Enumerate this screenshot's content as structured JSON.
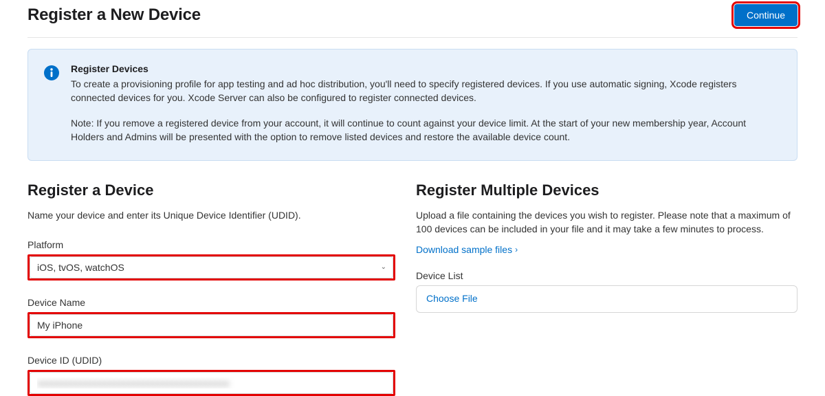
{
  "header": {
    "title": "Register a New Device",
    "continue_label": "Continue"
  },
  "info": {
    "heading": "Register Devices",
    "body1": "To create a provisioning profile for app testing and ad hoc distribution, you'll need to specify registered devices. If you use automatic signing, Xcode registers connected devices for you. Xcode Server can also be configured to register connected devices.",
    "body2": "Note: If you remove a registered device from your account, it will continue to count against your device limit. At the start of your new membership year, Account Holders and Admins will be presented with the option to remove listed devices and restore the available device count."
  },
  "left": {
    "title": "Register a Device",
    "desc": "Name your device and enter its Unique Device Identifier (UDID).",
    "platform_label": "Platform",
    "platform_value": "iOS, tvOS, watchOS",
    "device_name_label": "Device Name",
    "device_name_value": "My iPhone",
    "device_id_label": "Device ID (UDID)",
    "device_id_value": "xxxxxxxxxxxxxxxxxxxxxxxxxxxxxxxxxxxxxxxx"
  },
  "right": {
    "title": "Register Multiple Devices",
    "desc": "Upload a file containing the devices you wish to register. Please note that a maximum of 100 devices can be included in your file and it may take a few minutes to process.",
    "download_label": "Download sample files",
    "device_list_label": "Device List",
    "choose_file_label": "Choose File"
  }
}
